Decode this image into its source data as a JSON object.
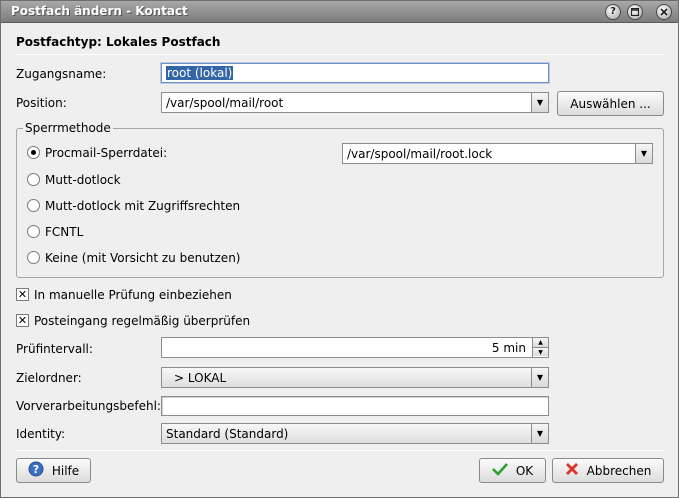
{
  "window": {
    "title": "Postfach ändern - Kontact",
    "help_icon": "question-icon",
    "maximize_icon": "maximize-icon",
    "close_icon": "close-icon"
  },
  "heading": "Postfachtyp: Lokales Postfach",
  "account_name": {
    "label": "Zugangsname:",
    "value": "root (lokal)"
  },
  "position": {
    "label": "Position:",
    "value": "/var/spool/mail/root",
    "choose_button": "Auswählen ..."
  },
  "locking": {
    "group_title": "Sperrmethode",
    "options": [
      {
        "label": "Procmail-Sperrdatei:",
        "checked": true
      },
      {
        "label": "Mutt-dotlock",
        "checked": false
      },
      {
        "label": "Mutt-dotlock mit Zugriffsrechten",
        "checked": false
      },
      {
        "label": "FCNTL",
        "checked": false
      },
      {
        "label": "Keine (mit Vorsicht zu benutzen)",
        "checked": false
      }
    ],
    "procmail_file": "/var/spool/mail/root.lock"
  },
  "manual_check": {
    "label": "In manuelle Prüfung einbeziehen",
    "checked": true
  },
  "interval_check": {
    "label": "Posteingang regelmäßig überprüfen",
    "checked": true
  },
  "check_interval": {
    "label": "Prüfintervall:",
    "value": "5 min"
  },
  "target_folder": {
    "label": "Zielordner:",
    "value": "> LOKAL"
  },
  "precommand": {
    "label": "Vorverarbeitungsbefehl:",
    "value": ""
  },
  "identity": {
    "label": "Identity:",
    "value": "Standard (Standard)"
  },
  "buttons": {
    "help": "Hilfe",
    "ok": "OK",
    "cancel": "Abbrechen"
  },
  "colors": {
    "titlebar": "#8c8c8c",
    "selection": "#3465a4",
    "ok_check": "#2e9e2e",
    "cancel_x": "#d8332b",
    "help_icon": "#3b6fc4"
  }
}
